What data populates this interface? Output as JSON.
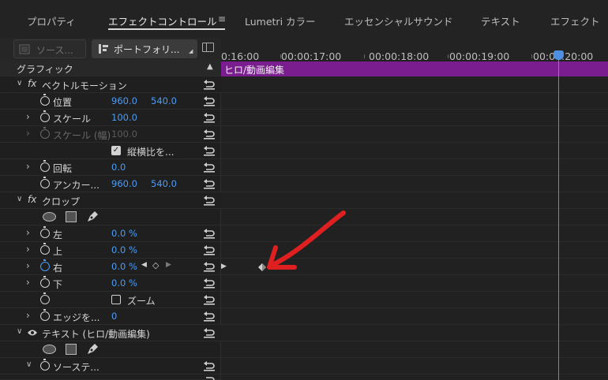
{
  "tabs": [
    {
      "label": "プロパティ",
      "active": false
    },
    {
      "label": "エフェクトコントロール",
      "active": true
    },
    {
      "label": "Lumetri カラー",
      "active": false
    },
    {
      "label": "エッセンシャルサウンド",
      "active": false
    },
    {
      "label": "テキスト",
      "active": false
    },
    {
      "label": "エフェクト",
      "active": false
    }
  ],
  "tab_menu_icon": "≡",
  "source_button": "ソース...",
  "portfolio_button": "ポートフォリ...",
  "section_title": "グラフィック",
  "motion": {
    "title": "ベクトルモーション",
    "position_label": "位置",
    "position_x": "960.0",
    "position_y": "540.0",
    "scale_label": "スケール",
    "scale_value": "100.0",
    "scale_width_label": "スケール (幅)",
    "scale_width_value": "100.0",
    "uniform_label": "縦横比を...",
    "rotation_label": "回転",
    "rotation_value": "0.0",
    "anchor_label": "アンカー...",
    "anchor_x": "960.0",
    "anchor_y": "540.0"
  },
  "crop": {
    "title": "クロップ",
    "left_label": "左",
    "left_value": "0.0 %",
    "top_label": "上",
    "top_value": "0.0 %",
    "right_label": "右",
    "right_value": "0.0 %",
    "bottom_label": "下",
    "bottom_value": "0.0 %",
    "zoom_label": "ズーム",
    "edge_label": "エッジを...",
    "edge_value": "0"
  },
  "text_layer": {
    "title": "テキスト (ヒロ/動画編集)",
    "source_label": "ソーステ..."
  },
  "ruler_ticks": [
    "0:16:00",
    "00:00:17:00",
    "00:00:18:00",
    "00:00:19:00",
    "00:00:20:00"
  ],
  "clip_label": "ヒロ/動画編集",
  "colors": {
    "accent": "#4d9cf4",
    "clip": "#7a1e8f",
    "arrow": "#e02020"
  }
}
